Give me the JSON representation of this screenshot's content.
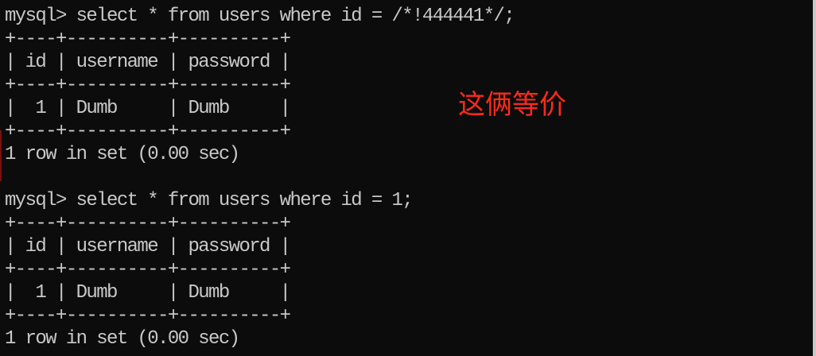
{
  "terminal": {
    "lines": [
      "mysql> select * from users where id = /*!444441*/;",
      "+----+----------+----------+",
      "| id | username | password |",
      "+----+----------+----------+",
      "|  1 | Dumb     | Dumb     |",
      "+----+----------+----------+",
      "1 row in set (0.00 sec)",
      "",
      "mysql> select * from users where id = 1;",
      "+----+----------+----------+",
      "| id | username | password |",
      "+----+----------+----------+",
      "|  1 | Dumb     | Dumb     |",
      "+----+----------+----------+",
      "1 row in set (0.00 sec)"
    ]
  },
  "annotation": {
    "text": "这俩等价",
    "color": "#ff2a1a"
  },
  "colors": {
    "background": "#0c0c0c",
    "terminal_text": "#c8c8c8"
  }
}
